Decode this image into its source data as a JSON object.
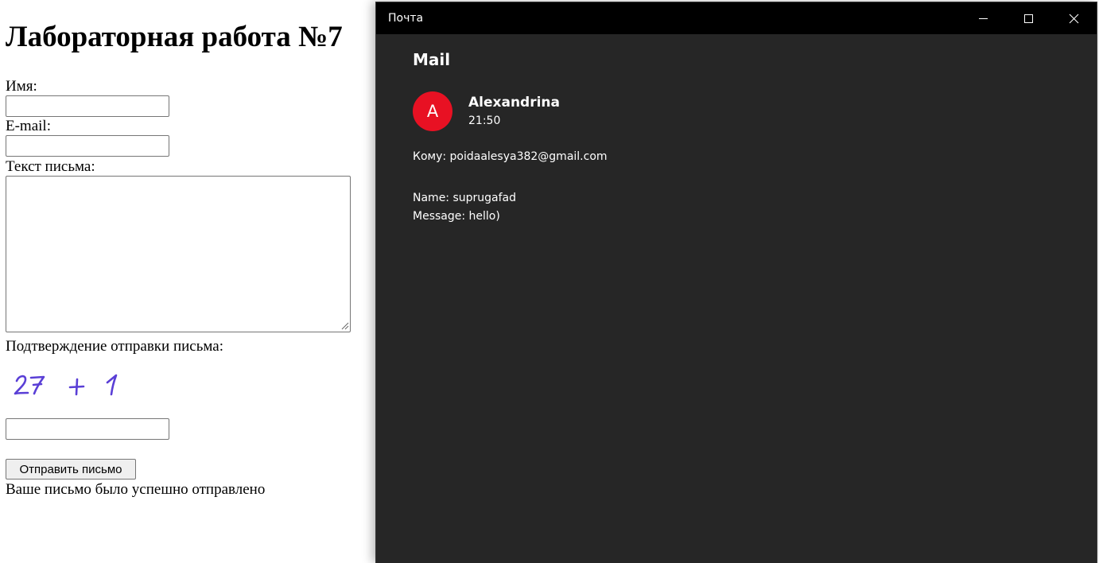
{
  "web_page": {
    "heading": "Лабораторная работа №7",
    "name_label": "Имя:",
    "name_value": "",
    "email_label": "E-mail:",
    "email_value": "",
    "message_label": "Текст письма:",
    "message_value": "",
    "confirm_label": "Подтверждение отправки письма:",
    "captcha": {
      "expression": "27 + 1",
      "color": "#5a3fd6"
    },
    "captcha_answer_value": "",
    "submit_label": "Отправить письмо",
    "success_message": "Ваше письмо было успешно отправлено"
  },
  "mail_window": {
    "title": "Почта",
    "controls": {
      "minimize_icon": "minimize-icon",
      "maximize_icon": "maximize-icon",
      "close_icon": "close-icon"
    },
    "heading": "Mail",
    "sender": {
      "initial": "A",
      "avatar_color": "#e81123",
      "name": "Alexandrina",
      "time": "21:50"
    },
    "recipient": "Кому: poidaalesya382@gmail.com",
    "body_lines": [
      "Name: suprugafad",
      "Message: hello)"
    ]
  },
  "colors": {
    "titlebar": "#000000",
    "mail_background": "#262626",
    "page_background": "#ffffff"
  }
}
